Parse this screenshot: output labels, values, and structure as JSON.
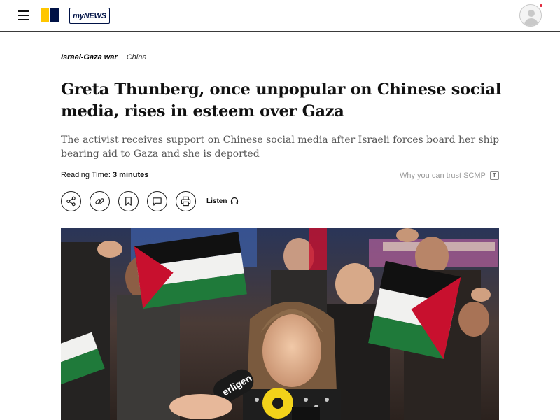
{
  "header": {
    "menu_icon": "hamburger-menu-icon",
    "logo_colors": {
      "yellow": "#ffc600",
      "navy": "#001246"
    },
    "mynews_label": "myNEWS",
    "avatar_icon": "user-avatar-icon"
  },
  "article": {
    "tags": [
      "Israel-Gaza war",
      "China"
    ],
    "headline": "Greta Thunberg, once unpopular on Chinese social media, rises in esteem over Gaza",
    "subheadline": "The activist receives support on Chinese social media after Israeli forces board her ship bearing aid to Gaza and she is deported",
    "reading_time_label": "Reading Time:",
    "reading_time_value": "3 minutes",
    "trust_link": "Why you can trust SCMP",
    "actions": [
      "share-icon",
      "copy-link-icon",
      "bookmark-icon",
      "comment-icon",
      "print-icon"
    ],
    "listen_label": "Listen",
    "hero_text": [
      "erligen"
    ]
  }
}
